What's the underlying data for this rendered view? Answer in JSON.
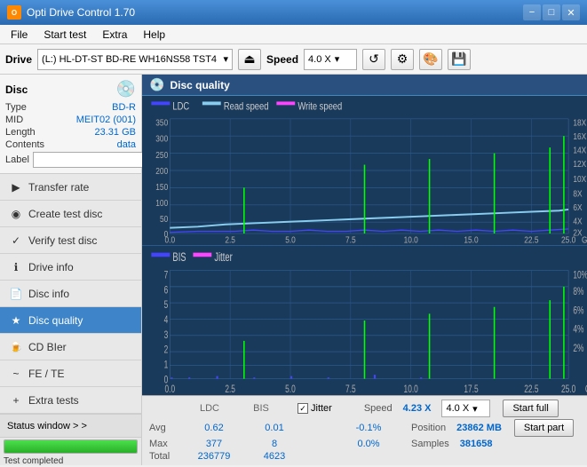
{
  "titleBar": {
    "title": "Opti Drive Control 1.70",
    "iconLabel": "O",
    "minimizeLabel": "−",
    "maximizeLabel": "□",
    "closeLabel": "✕"
  },
  "menuBar": {
    "items": [
      "File",
      "Start test",
      "Extra",
      "Help"
    ]
  },
  "toolbar": {
    "driveLabel": "Drive",
    "driveValue": "(L:)  HL-DT-ST BD-RE  WH16NS58 TST4",
    "speedLabel": "Speed",
    "speedValue": "4.0 X"
  },
  "disc": {
    "title": "Disc",
    "type": "BD-R",
    "mid": "MEIT02 (001)",
    "length": "23.31 GB",
    "contents": "data",
    "labelKey": "Label",
    "labelValue": ""
  },
  "navItems": [
    {
      "id": "transfer-rate",
      "label": "Transfer rate",
      "icon": "▶"
    },
    {
      "id": "create-test-disc",
      "label": "Create test disc",
      "icon": "◉"
    },
    {
      "id": "verify-test-disc",
      "label": "Verify test disc",
      "icon": "✓"
    },
    {
      "id": "drive-info",
      "label": "Drive info",
      "icon": "ℹ"
    },
    {
      "id": "disc-info",
      "label": "Disc info",
      "icon": "📄"
    },
    {
      "id": "disc-quality",
      "label": "Disc quality",
      "icon": "★",
      "active": true
    },
    {
      "id": "cd-bier",
      "label": "CD BIer",
      "icon": "🍺"
    },
    {
      "id": "fe-te",
      "label": "FE / TE",
      "icon": "~"
    },
    {
      "id": "extra-tests",
      "label": "Extra tests",
      "icon": "+"
    }
  ],
  "statusWindow": {
    "label": "Status window > >"
  },
  "progressBar": {
    "percent": 100,
    "statusText": "Test completed"
  },
  "discQuality": {
    "title": "Disc quality",
    "legend": {
      "ldc": "LDC",
      "readSpeed": "Read speed",
      "writeSpeed": "Write speed",
      "bis": "BIS",
      "jitter": "Jitter"
    }
  },
  "statsPanel": {
    "headers": [
      "",
      "LDC",
      "BIS",
      "",
      "Jitter",
      "Speed",
      ""
    ],
    "rows": [
      {
        "label": "Avg",
        "ldc": "0.62",
        "bis": "0.01",
        "jitter": "-0.1%",
        "speed": "4.23 X",
        "speedTarget": "4.0 X"
      },
      {
        "label": "Max",
        "ldc": "377",
        "bis": "8",
        "jitter": "0.0%",
        "position": "23862 MB"
      },
      {
        "label": "Total",
        "ldc": "236779",
        "bis": "4623",
        "samples": "381658"
      }
    ],
    "jitterChecked": true,
    "startFullLabel": "Start full",
    "startPartLabel": "Start part",
    "positionLabel": "Position",
    "samplesLabel": "Samples"
  }
}
